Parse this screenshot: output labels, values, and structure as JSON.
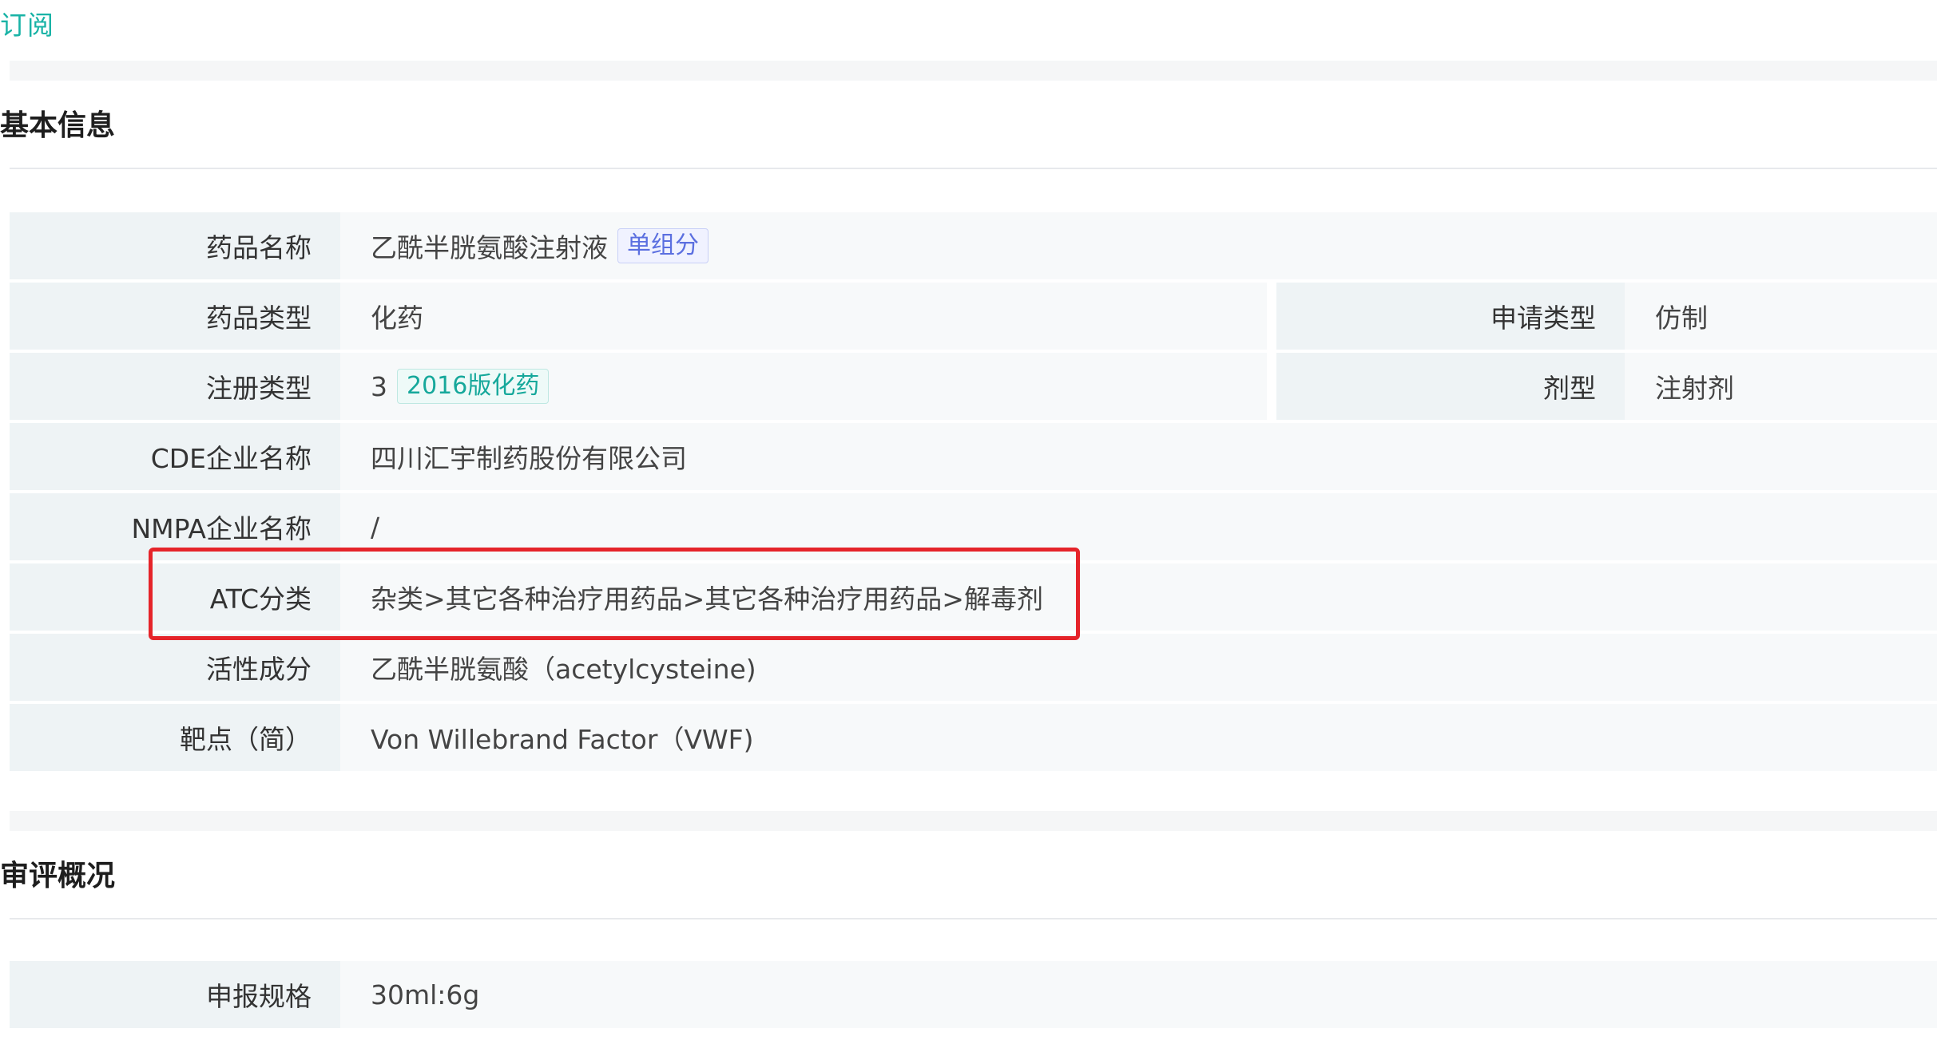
{
  "header": {
    "subscribe_link": "订阅"
  },
  "basic_info": {
    "title": "基本信息",
    "rows": [
      {
        "label": "药品名称",
        "value": "乙酰半胱氨酸注射液",
        "tag": "单组分"
      },
      {
        "label": "药品类型",
        "value": "化药",
        "right_label": "申请类型",
        "right_value": "仿制"
      },
      {
        "label": "注册类型",
        "value": "3",
        "tag": "2016版化药",
        "right_label": "剂型",
        "right_value": "注射剂"
      },
      {
        "label": "CDE企业名称",
        "value": "四川汇宇制药股份有限公司"
      },
      {
        "label": "NMPA企业名称",
        "value": "/"
      },
      {
        "label": "ATC分类",
        "value": "杂类>其它各种治疗用药品>其它各种治疗用药品>解毒剂"
      },
      {
        "label": "活性成分",
        "value": "乙酰半胱氨酸（acetylcysteine)"
      },
      {
        "label": "靶点（简）",
        "value": "Von Willebrand Factor（VWF)"
      }
    ]
  },
  "review_overview": {
    "title": "审评概况",
    "rows": [
      {
        "label": "申报规格",
        "value": "30ml:6g"
      }
    ]
  },
  "colors": {
    "accent": "#19b3a6",
    "highlight": "#e5242a",
    "tag_purple": "#5b6fe0",
    "tag_teal": "#16a89b"
  }
}
